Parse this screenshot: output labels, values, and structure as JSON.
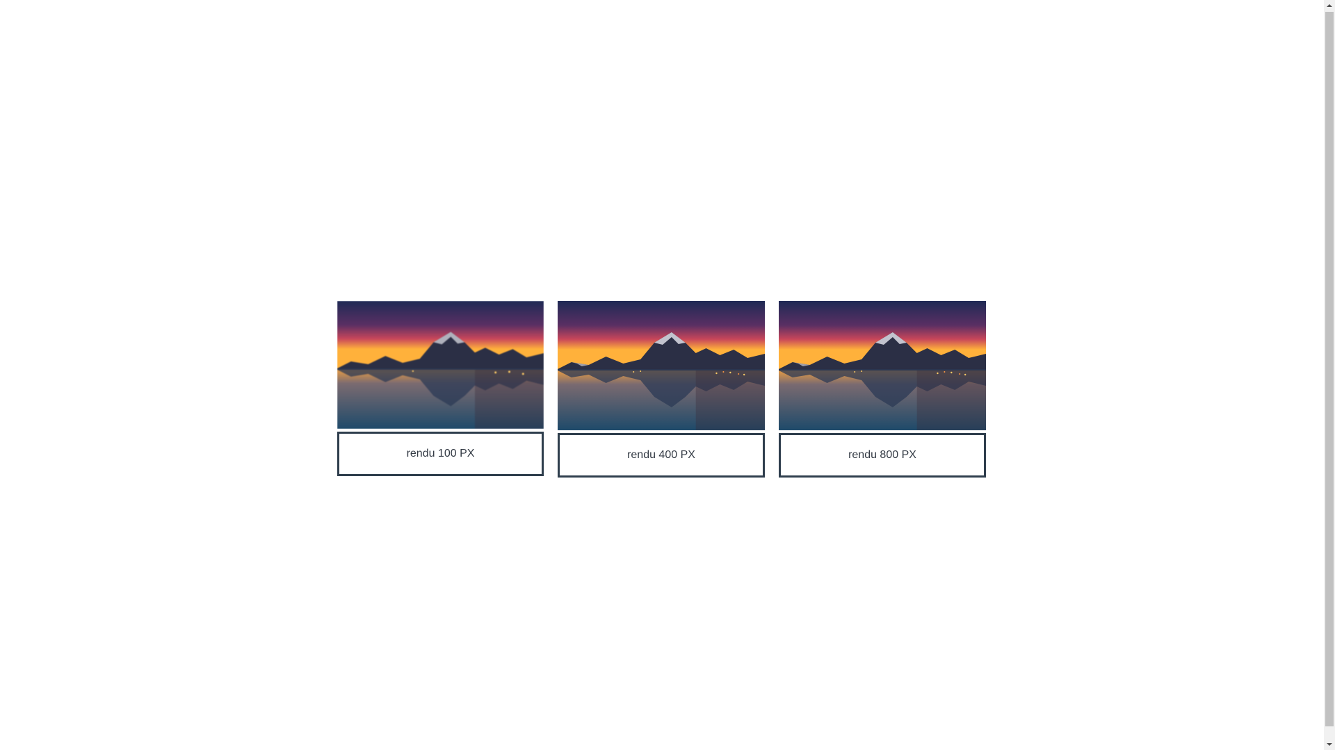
{
  "gallery": {
    "items": [
      {
        "caption": "rendu 100 PX",
        "image_alt": "mountain-lake-sunset-image"
      },
      {
        "caption": "rendu 400 PX",
        "image_alt": "mountain-lake-sunset-image"
      },
      {
        "caption": "rendu 800 PX",
        "image_alt": "mountain-lake-sunset-image"
      }
    ]
  },
  "colors": {
    "caption_border": "#2f3e4d",
    "caption_text": "#333a44",
    "sky_top": "#2a2a5a",
    "sky_mid": "#8a2f5a",
    "horizon": "#ffb13b",
    "water": "#2e5a7a"
  }
}
